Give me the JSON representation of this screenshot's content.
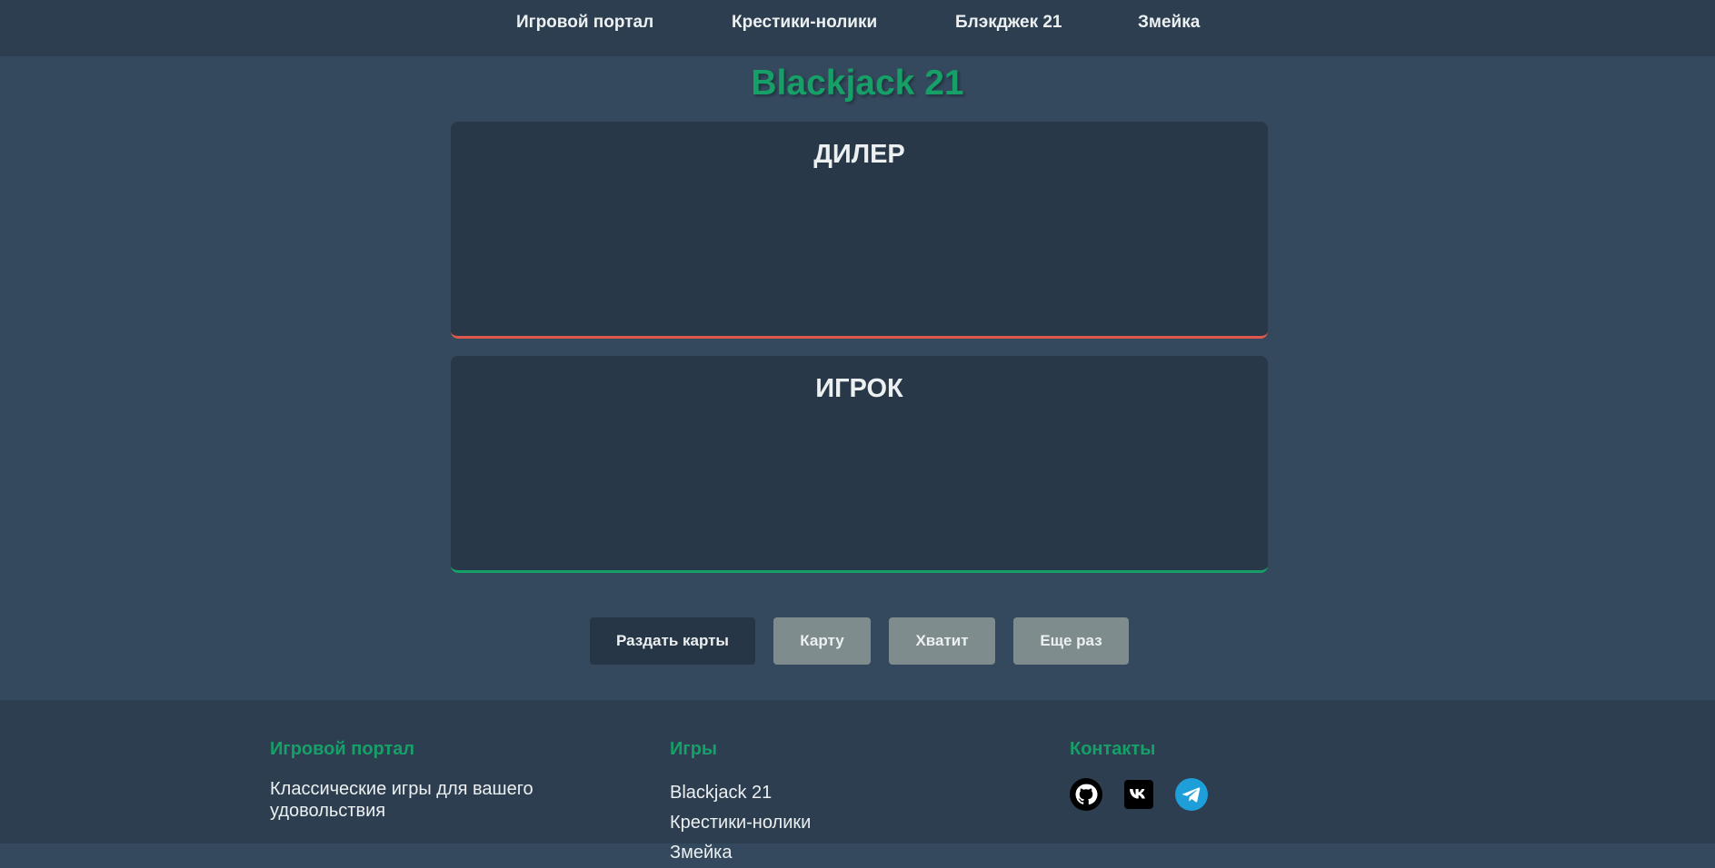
{
  "nav": {
    "links": [
      "Игровой портал",
      "Крестики-нолики",
      "Блэкджек 21",
      "Змейка"
    ]
  },
  "main": {
    "title": "Blackjack 21",
    "dealer_label": "ДИЛЕР",
    "player_label": "ИГРОК"
  },
  "controls": {
    "deal": "Раздать карты",
    "hit": "Карту",
    "stand": "Хватит",
    "again": "Еще раз"
  },
  "footer": {
    "col1_title": "Игровой портал",
    "col1_text": "Классические игры для вашего удовольствия",
    "col2_title": "Игры",
    "games": [
      "Blackjack 21",
      "Крестики-нолики",
      "Змейка"
    ],
    "col3_title": "Контакты",
    "icons": [
      "github-icon",
      "vk-icon",
      "telegram-icon"
    ]
  },
  "colors": {
    "accent": "#16a067",
    "dealer_border": "#e0574b",
    "background": "#34495e",
    "header": "#2c3e50"
  }
}
